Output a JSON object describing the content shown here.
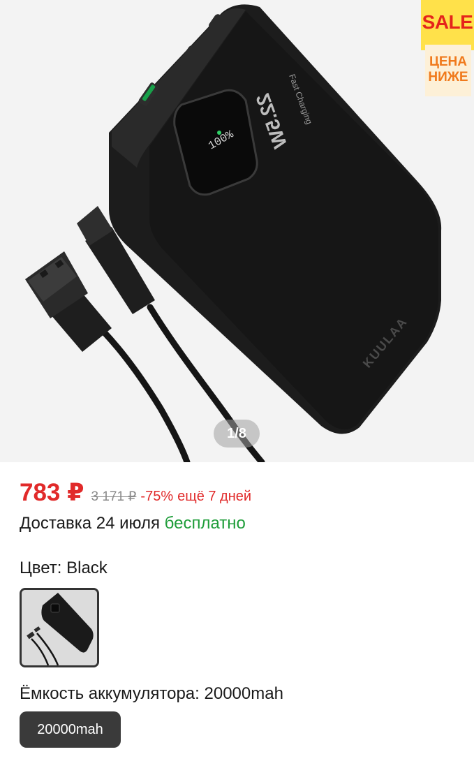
{
  "gallery": {
    "image_name": "power-bank-product-photo",
    "device_screen_text": "100%",
    "device_power_text": "22.5W",
    "device_subtitle": "Fast Charging",
    "device_brand": "KUULAA",
    "counter": "1/8"
  },
  "badge": {
    "sale_text": "SALE",
    "promo_line1": "ЦЕНА",
    "promo_line2": "НИЖЕ"
  },
  "price": {
    "current": "783 ₽",
    "old": "3 171 ₽",
    "discount": "-75%",
    "note": "ещё 7 дней"
  },
  "delivery": {
    "text": "Доставка 24 июля",
    "free": "бесплатно"
  },
  "color": {
    "label": "Цвет: Black"
  },
  "capacity": {
    "label": "Ёмкость аккумулятора: 20000mah",
    "selected": "20000mah"
  },
  "colors": {
    "price_red": "#e12a2a",
    "free_green": "#1f9d3a",
    "sale_yellow": "#ffe14a",
    "sale_red": "#e5241b",
    "chip_dark": "#3a3a3a"
  }
}
